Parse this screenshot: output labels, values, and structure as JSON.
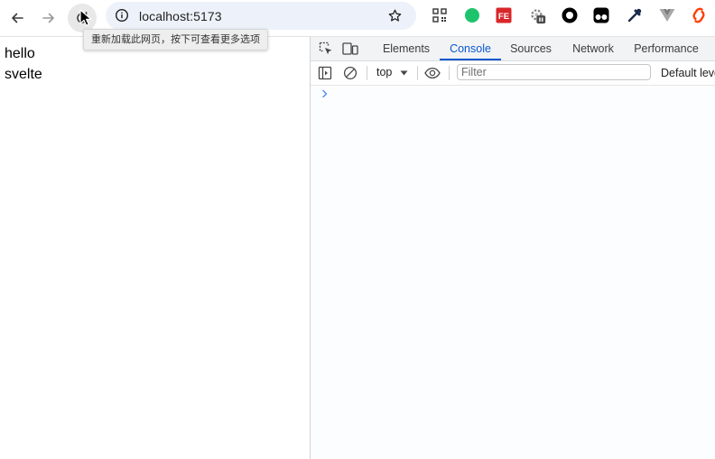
{
  "browser": {
    "url": "localhost:5173",
    "reload_tooltip": "重新加载此网页，按下可查看更多选项",
    "icons": {
      "back": "arrow-left-icon",
      "forward": "arrow-right-icon",
      "reload": "reload-icon",
      "site_info": "info-icon",
      "bookmark": "star-icon"
    },
    "extensions": [
      {
        "name": "qr-code-extension-icon",
        "color": "#333333"
      },
      {
        "name": "green-dot-extension-icon",
        "color": "#1ec46b"
      },
      {
        "name": "fe-helper-extension-icon",
        "color": "#d9262b",
        "label": "FE"
      },
      {
        "name": "gear-paused-extension-icon",
        "color": "#8a8a8a"
      },
      {
        "name": "black-ring-extension-icon",
        "color": "#000000"
      },
      {
        "name": "tampermonkey-extension-icon",
        "color": "#000000"
      },
      {
        "name": "eyedropper-extension-icon",
        "color": "#1a2b4c"
      },
      {
        "name": "vue-devtools-extension-icon",
        "color": "#9a9a9a"
      },
      {
        "name": "svelte-extension-icon",
        "color": "#ff3e00"
      }
    ]
  },
  "page": {
    "lines": [
      "hello",
      "svelte"
    ]
  },
  "devtools": {
    "tabs": [
      "Elements",
      "Console",
      "Sources",
      "Network",
      "Performance"
    ],
    "active_tab": "Console",
    "console": {
      "context": "top",
      "filter_placeholder": "Filter",
      "levels": "Default leve"
    },
    "accent": "#0b57d0"
  }
}
